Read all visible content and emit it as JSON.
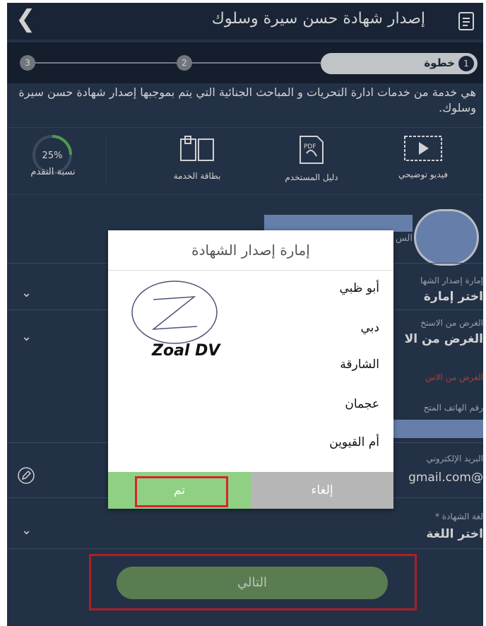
{
  "header": {
    "title": "إصدار شهادة حسن سيرة وسلوك"
  },
  "steps": {
    "current_label": "خطوة",
    "items": [
      "1",
      "2",
      "3"
    ]
  },
  "description": "هي خدمة من خدمات ادارة التحريات و المباحث الجنائية التي يتم بموجبها إصدار شهادة حسن سيرة وسلوك.",
  "shortcuts": {
    "video": "فيديو توضيحي",
    "guide": "دليل المستخدم",
    "guide_badge": "PDF",
    "card": "بطاقة الخدمة",
    "progress_label": "نسبة التقدم",
    "progress_value": "25%",
    "progress_fraction": 0.25
  },
  "form": {
    "name_label_partial": "الس",
    "emirate_label": "إمارة إصدار الشها",
    "emirate_value": "اختر إمارة",
    "purpose_label": "الغرض من الاستخ",
    "purpose_value": "الغرض من الا",
    "purpose_error": "الغرض من الاس",
    "phone_label": "رقم الهاتف المتح",
    "email_label": "البريد الإلكتروني",
    "email_value": "@gmail.com",
    "language_label": "لغة الشهادة",
    "language_required": "*",
    "language_value": "اختر اللغة"
  },
  "next_button": "التالي",
  "dialog": {
    "title": "إمارة إصدار الشهادة",
    "options": [
      "أبو ظبي",
      "دبي",
      "الشارقة",
      "عجمان",
      "أم القيوين"
    ],
    "ok": "تم",
    "cancel": "إلغاء"
  },
  "watermark": {
    "text": "Zoal DV"
  },
  "colors": {
    "header_bg": "#1f2d43",
    "screen_bg": "#2b3c56",
    "accent_green": "#90d083",
    "highlight_red": "#d3252f",
    "field_blue": "#7d9bd0"
  }
}
